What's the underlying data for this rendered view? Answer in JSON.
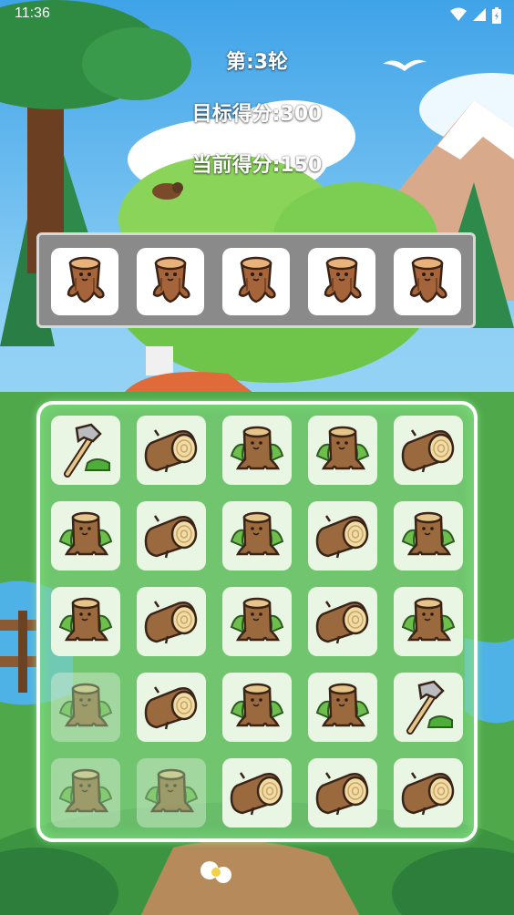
{
  "status": {
    "time": "11:36"
  },
  "hud": {
    "round": "第:3轮",
    "target_score": "目标得分:300",
    "current_score": "当前得分:150"
  },
  "slot_bar": {
    "capacity": 5,
    "items": [
      "stump-standing",
      "stump-standing",
      "stump-standing",
      "stump-standing",
      "stump-standing"
    ]
  },
  "board": {
    "rows": 5,
    "cols": 5,
    "tiles": [
      [
        {
          "t": "axe",
          "dim": false
        },
        {
          "t": "log",
          "dim": false
        },
        {
          "t": "stump",
          "dim": false
        },
        {
          "t": "stump",
          "dim": false
        },
        {
          "t": "log",
          "dim": false
        }
      ],
      [
        {
          "t": "stump",
          "dim": false
        },
        {
          "t": "log",
          "dim": false
        },
        {
          "t": "stump",
          "dim": false
        },
        {
          "t": "log",
          "dim": false
        },
        {
          "t": "stump",
          "dim": false
        }
      ],
      [
        {
          "t": "stump",
          "dim": false
        },
        {
          "t": "log",
          "dim": false
        },
        {
          "t": "stump",
          "dim": false
        },
        {
          "t": "log",
          "dim": false
        },
        {
          "t": "stump",
          "dim": false
        }
      ],
      [
        {
          "t": "stump",
          "dim": true
        },
        {
          "t": "log",
          "dim": false
        },
        {
          "t": "stump",
          "dim": false
        },
        {
          "t": "stump",
          "dim": false
        },
        {
          "t": "axe",
          "dim": false
        }
      ],
      [
        {
          "t": "stump",
          "dim": true
        },
        {
          "t": "stump",
          "dim": true
        },
        {
          "t": "log",
          "dim": false
        },
        {
          "t": "log",
          "dim": false
        },
        {
          "t": "log",
          "dim": false
        }
      ]
    ]
  }
}
